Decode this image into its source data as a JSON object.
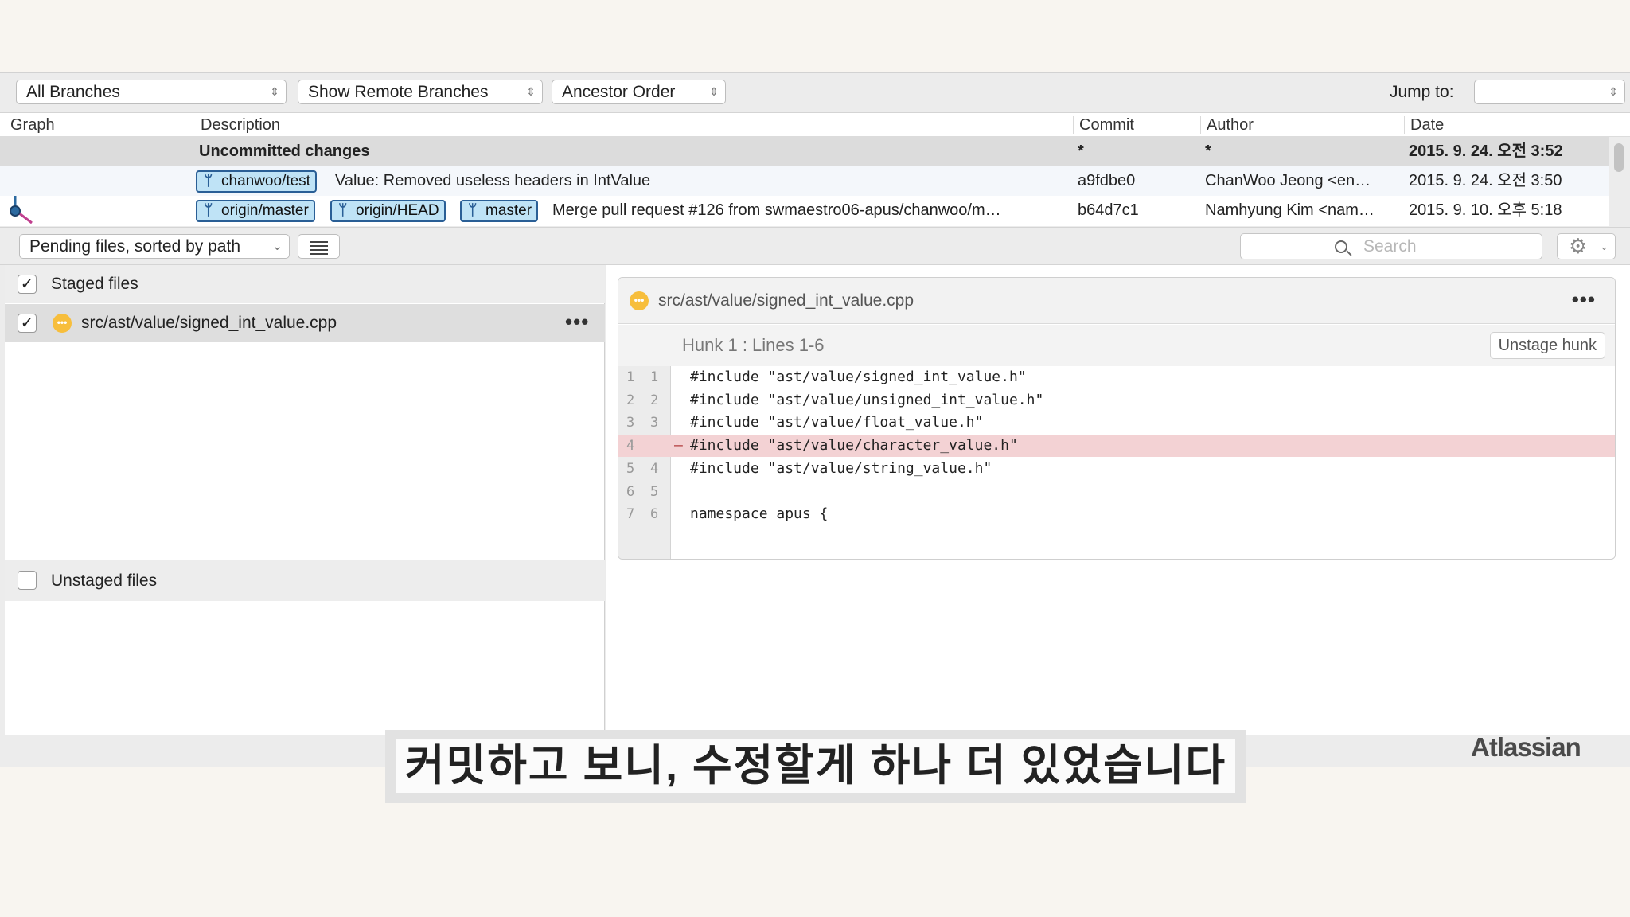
{
  "toolbar": {
    "branches_select": "All Branches",
    "remote_select": "Show Remote Branches",
    "order_select": "Ancestor Order",
    "jump_label": "Jump to:",
    "jump_value": ""
  },
  "commit_table": {
    "columns": [
      "Graph",
      "Description",
      "Commit",
      "Author",
      "Date"
    ],
    "rows": [
      {
        "description": "Uncommitted changes",
        "commit": "*",
        "author": "*",
        "date": "2015. 9. 24. 오전 3:52"
      },
      {
        "tags": [
          "chanwoo/test"
        ],
        "description": "Value: Removed useless headers in IntValue",
        "commit": "a9fdbe0",
        "author": "ChanWoo Jeong <en…",
        "date": "2015. 9. 24. 오전 3:50"
      },
      {
        "tags": [
          "origin/master",
          "origin/HEAD",
          "master"
        ],
        "description": "Merge pull request #126 from swmaestro06-apus/chanwoo/m…",
        "commit": "b64d7c1",
        "author": "Namhyung Kim <nam…",
        "date": "2015. 9. 10. 오후 5:18"
      }
    ]
  },
  "file_toolbar": {
    "filter_select": "Pending files, sorted by path",
    "search_placeholder": "Search"
  },
  "staged": {
    "label": "Staged files",
    "checked": true,
    "files": [
      {
        "path": "src/ast/value/signed_int_value.cpp",
        "checked": true,
        "status": "modified"
      }
    ]
  },
  "unstaged": {
    "label": "Unstaged files",
    "checked": false
  },
  "diff": {
    "file": "src/ast/value/signed_int_value.cpp",
    "hunk_label": "Hunk 1 : Lines 1-6",
    "unstage_label": "Unstage hunk",
    "lines": [
      {
        "old": "1",
        "new": "1",
        "sign": "",
        "code": "#include \"ast/value/signed_int_value.h\"",
        "type": "context"
      },
      {
        "old": "2",
        "new": "2",
        "sign": "",
        "code": "#include \"ast/value/unsigned_int_value.h\"",
        "type": "context"
      },
      {
        "old": "3",
        "new": "3",
        "sign": "",
        "code": "#include \"ast/value/float_value.h\"",
        "type": "context"
      },
      {
        "old": "4",
        "new": "",
        "sign": "–",
        "code": "#include \"ast/value/character_value.h\"",
        "type": "removed"
      },
      {
        "old": "5",
        "new": "4",
        "sign": "",
        "code": "#include \"ast/value/string_value.h\"",
        "type": "context"
      },
      {
        "old": "6",
        "new": "5",
        "sign": "",
        "code": "",
        "type": "context"
      },
      {
        "old": "7",
        "new": "6",
        "sign": "",
        "code": "namespace apus {",
        "type": "context"
      }
    ]
  },
  "caption": "커밋하고 보니, 수정할게 하나 더 있었습니다",
  "watermark": "Atlassian",
  "colors": {
    "tag_bg": "#bfe3f6",
    "tag_border": "#2a5f96",
    "removed_bg": "#f3d2d4",
    "status_modified": "#f7be3c"
  }
}
